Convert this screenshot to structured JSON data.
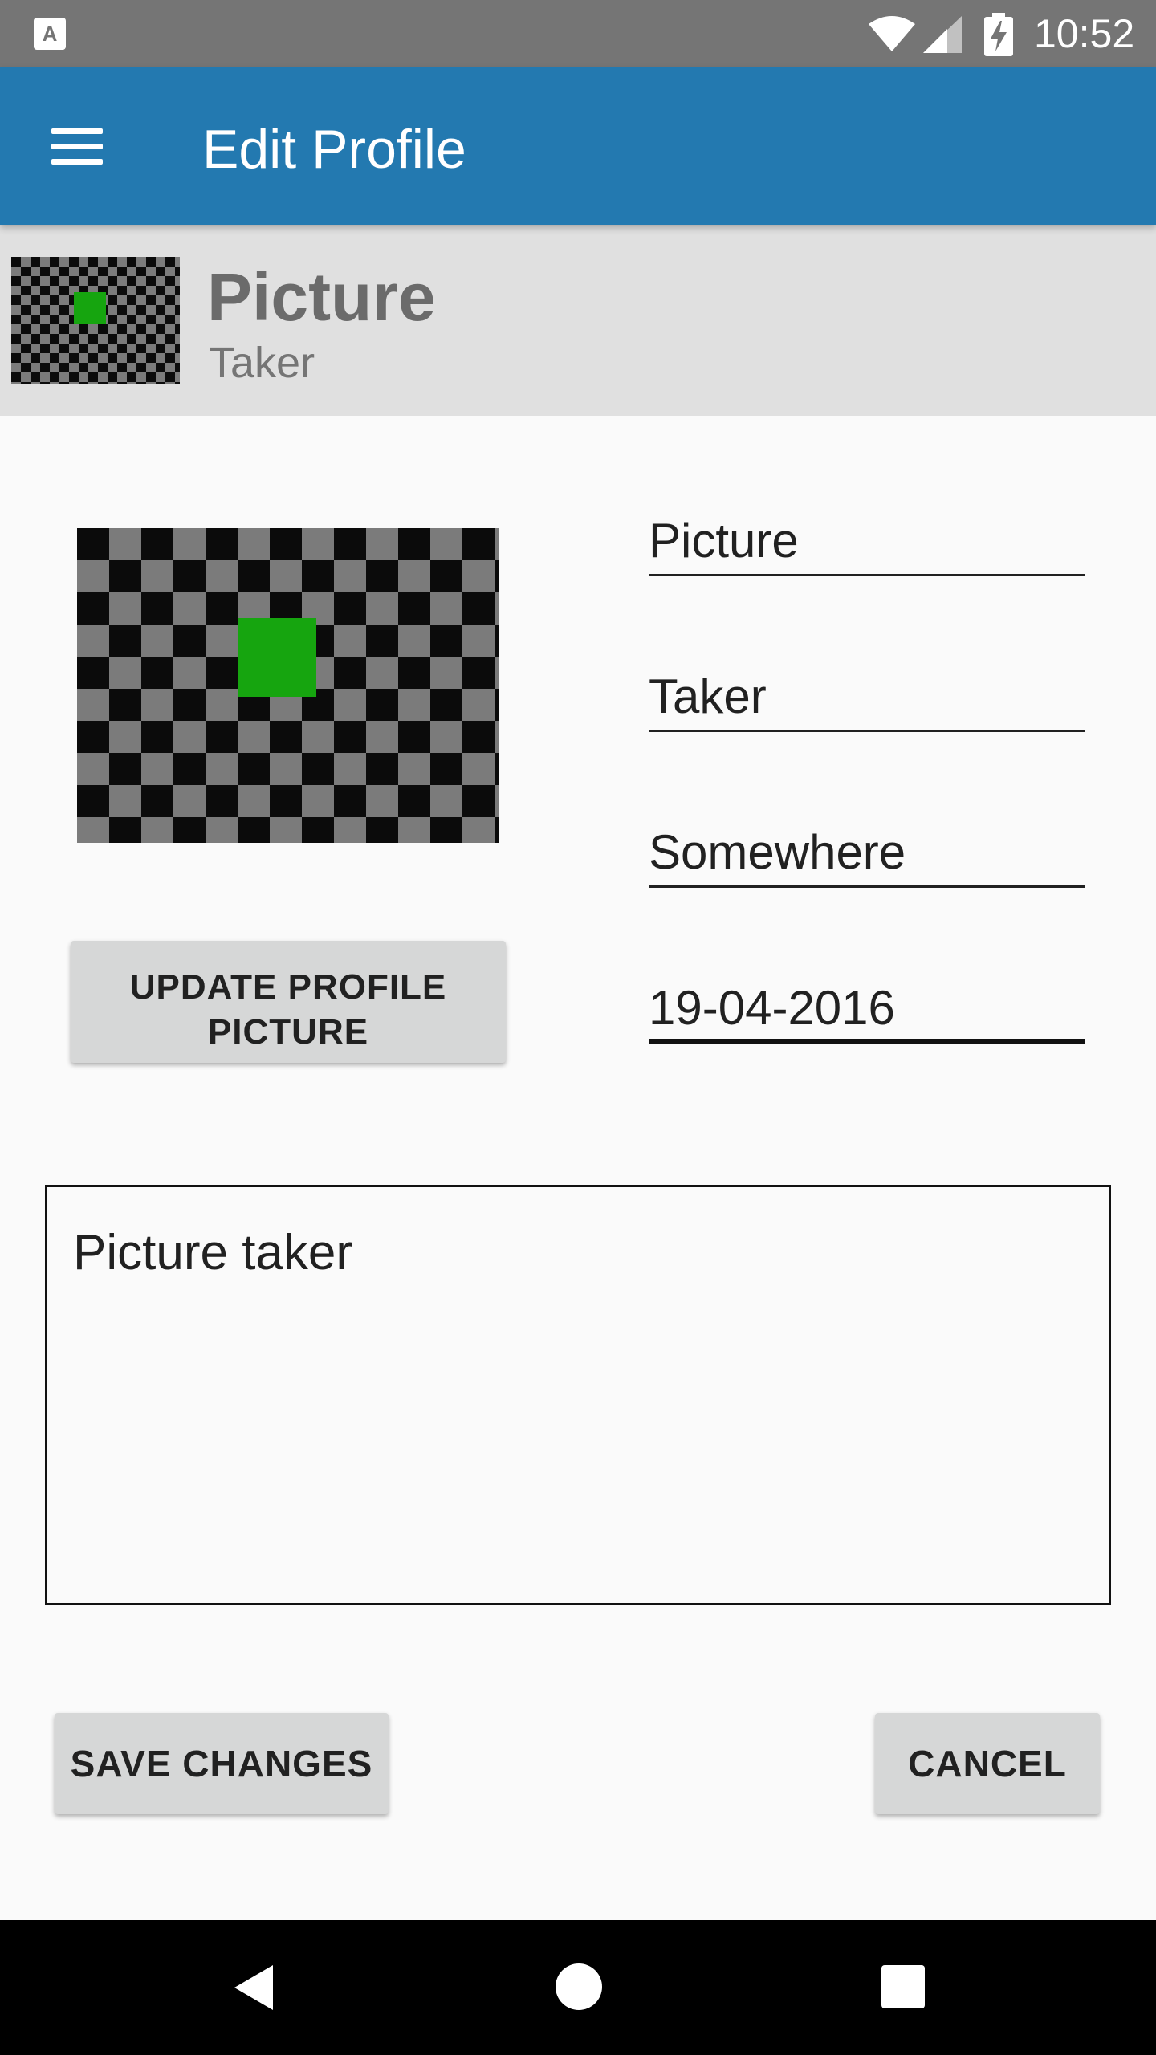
{
  "status_bar": {
    "app_icon_letter": "A",
    "icons": [
      "wifi-icon",
      "cell-signal-icon",
      "battery-charging-icon"
    ],
    "time": "10:52"
  },
  "app_bar": {
    "menu_icon": "hamburger-menu-icon",
    "title": "Edit Profile",
    "color": "#2379b0"
  },
  "header": {
    "name": "Picture",
    "subtitle": "Taker"
  },
  "profile": {
    "picture_pattern": "checkerboard with green square",
    "accent_green": "#16a50f",
    "update_button_label": "UPDATE PROFILE PICTURE"
  },
  "form": {
    "first_name": "Picture",
    "last_name": "Taker",
    "location": "Somewhere",
    "date": "19-04-2016",
    "bio": "Picture taker"
  },
  "actions": {
    "save_label": "SAVE CHANGES",
    "cancel_label": "CANCEL"
  },
  "nav_bar": {
    "icons": [
      "back-icon",
      "home-icon",
      "recents-icon"
    ]
  }
}
